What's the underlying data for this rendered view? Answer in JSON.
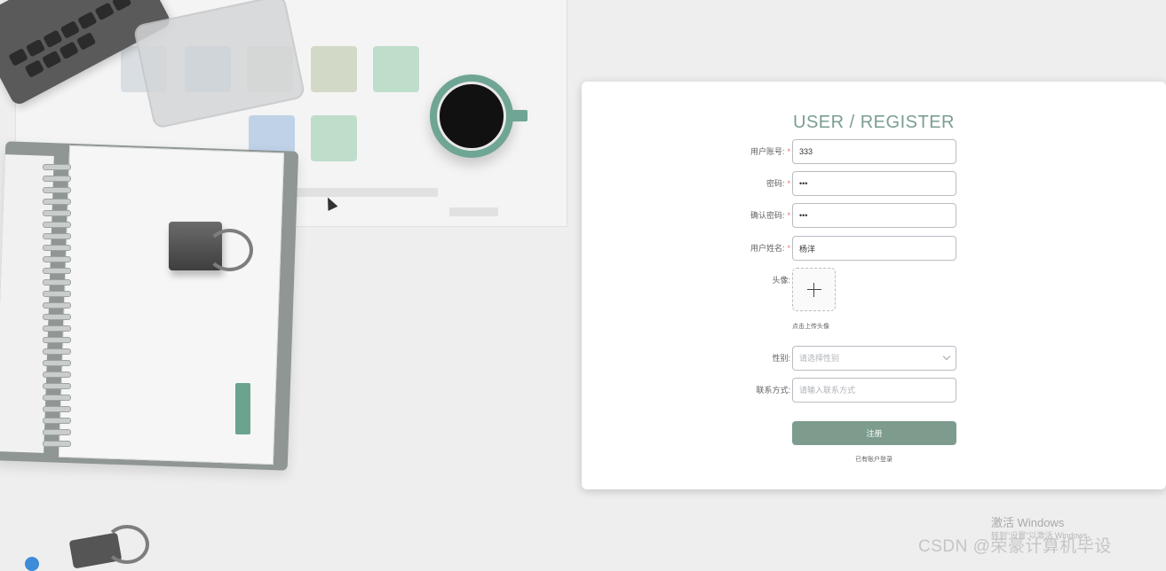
{
  "register": {
    "title": "USER / REGISTER",
    "fields": {
      "account": {
        "label": "用户账号:",
        "value": "333",
        "required": true
      },
      "password": {
        "label": "密码:",
        "value": "•••",
        "required": true
      },
      "confirm_password": {
        "label": "确认密码:",
        "value": "•••",
        "required": true
      },
      "name": {
        "label": "用户姓名:",
        "value": "杨洋",
        "required": true
      },
      "avatar": {
        "label": "头像:",
        "hint": "点击上传头像"
      },
      "gender": {
        "label": "性别:",
        "placeholder": "请选择性别"
      },
      "contact": {
        "label": "联系方式:",
        "placeholder": "请输入联系方式"
      }
    },
    "required_mark": "*",
    "submit_label": "注册",
    "login_link": "已有账户登录"
  },
  "watermark": {
    "activate_title": "激活 Windows",
    "activate_sub": "转到\"设置\"以激活 Windows。",
    "csdn": "CSDN @荣豪计算机毕设"
  },
  "colors": {
    "accent": "#7d9c8e",
    "title": "#7a9e8f",
    "required": "#f56c6c",
    "panel_bg": "#ffffff",
    "page_bg": "#eeeeee"
  }
}
